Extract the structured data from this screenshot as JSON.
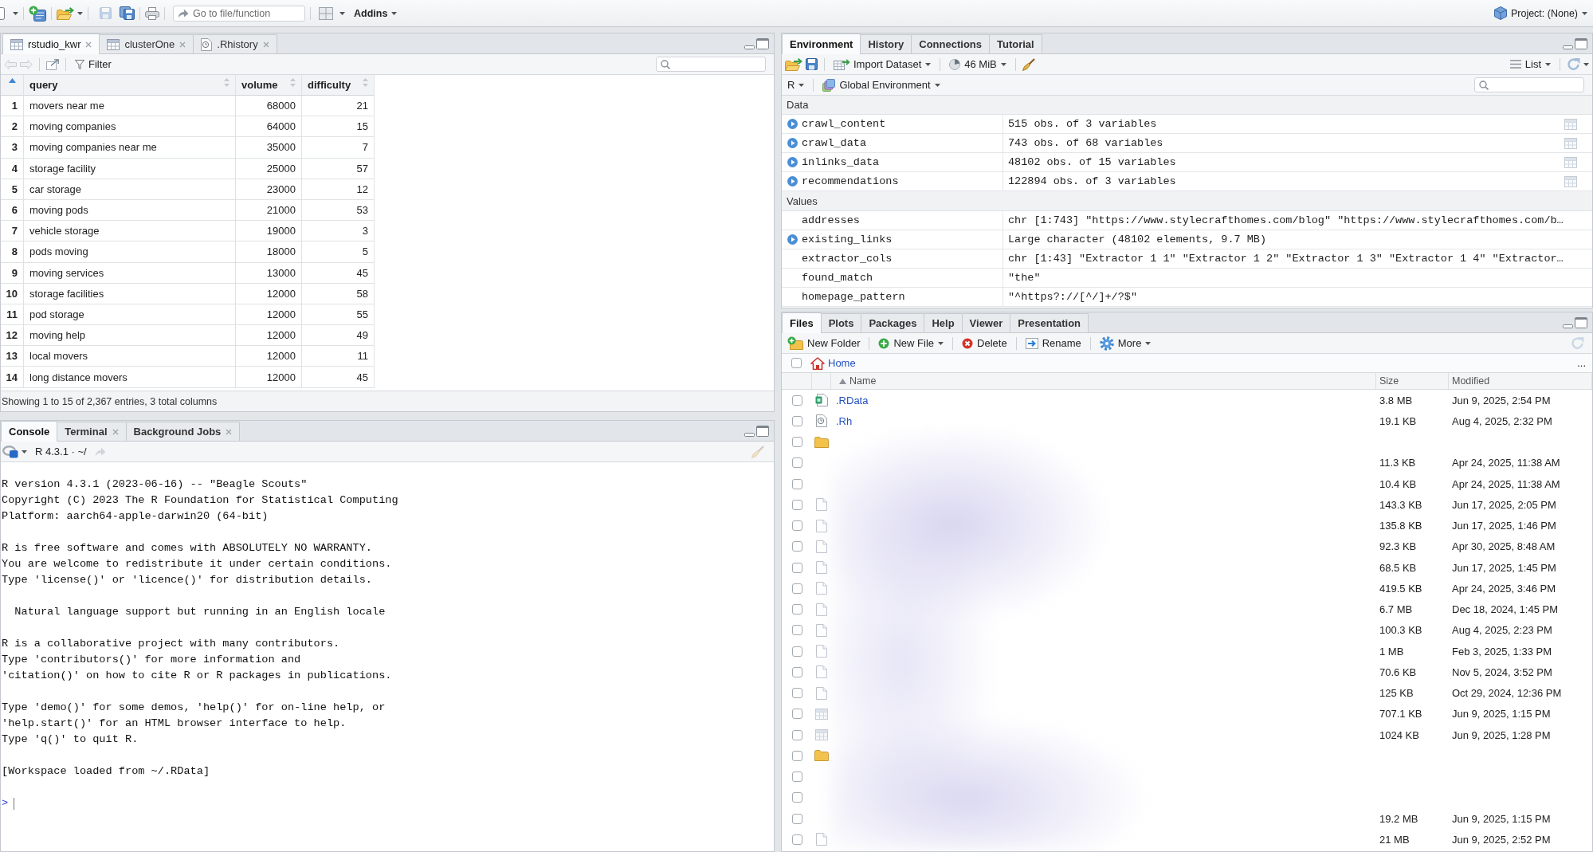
{
  "toolbar": {
    "save": {
      "disabled": true
    },
    "goto": {
      "placeholder": "Go to file/function"
    },
    "addins": "Addins",
    "project": "Project: (None)"
  },
  "source_pane": {
    "tabs": [
      {
        "label": "rstudio_kwr",
        "kind": "table",
        "closable": true,
        "selected": true
      },
      {
        "label": "clusterOne",
        "kind": "table",
        "closable": true,
        "selected": false
      },
      {
        "label": ".Rhistory",
        "kind": "history",
        "closable": true,
        "selected": false
      }
    ],
    "history_nav": {
      "disabled": true
    },
    "filter": "Filter",
    "table": {
      "index_sorted": true,
      "columns": [
        "query",
        "volume",
        "difficulty"
      ],
      "rows": [
        {
          "index": "1",
          "cells": [
            "movers near me",
            "68000",
            "21"
          ]
        },
        {
          "index": "2",
          "cells": [
            "moving companies",
            "64000",
            "15"
          ]
        },
        {
          "index": "3",
          "cells": [
            "moving companies near me",
            "35000",
            "7"
          ]
        },
        {
          "index": "4",
          "cells": [
            "storage facility",
            "25000",
            "57"
          ]
        },
        {
          "index": "5",
          "cells": [
            "car storage",
            "23000",
            "12"
          ]
        },
        {
          "index": "6",
          "cells": [
            "moving pods",
            "21000",
            "53"
          ]
        },
        {
          "index": "7",
          "cells": [
            "vehicle storage",
            "19000",
            "3"
          ]
        },
        {
          "index": "8",
          "cells": [
            "pods moving",
            "18000",
            "5"
          ]
        },
        {
          "index": "9",
          "cells": [
            "moving services",
            "13000",
            "45"
          ]
        },
        {
          "index": "10",
          "cells": [
            "storage facilities",
            "12000",
            "58"
          ]
        },
        {
          "index": "11",
          "cells": [
            "pod storage",
            "12000",
            "55"
          ]
        },
        {
          "index": "12",
          "cells": [
            "moving help",
            "12000",
            "49"
          ]
        },
        {
          "index": "13",
          "cells": [
            "local movers",
            "12000",
            "11"
          ]
        },
        {
          "index": "14",
          "cells": [
            "long distance movers",
            "12000",
            "45"
          ]
        }
      ]
    },
    "footer": "Showing 1 to 15 of 2,367 entries, 3 total columns"
  },
  "console_pane": {
    "tabs": [
      {
        "label": "Console",
        "closable": false,
        "selected": true
      },
      {
        "label": "Terminal",
        "closable": true,
        "selected": false
      },
      {
        "label": "Background Jobs",
        "closable": true,
        "selected": false
      }
    ],
    "interpreter": "R 4.3.1 · ~/",
    "output": [
      [
        "R version 4.3.1 (2023-06-16) -- \"Beagle Scouts\"",
        "Copyright (C) 2023 The R Foundation for Statistical Computing",
        "Platform: aarch64-apple-darwin20 (64-bit)"
      ],
      [
        "R is free software and comes with ABSOLUTELY NO WARRANTY.",
        "You are welcome to redistribute it under certain conditions.",
        "Type 'license()' or 'licence()' for distribution details."
      ],
      [
        "  Natural language support but running in an English locale"
      ],
      [
        "R is a collaborative project with many contributors.",
        "Type 'contributors()' for more information and",
        "'citation()' on how to cite R or R packages in publications."
      ],
      [
        "Type 'demo()' for some demos, 'help()' for on-line help, or",
        "'help.start()' for an HTML browser interface to help.",
        "Type 'q()' to quit R."
      ],
      [
        "[Workspace loaded from ~/.RData]"
      ]
    ],
    "prompt": ">"
  },
  "environment_pane": {
    "tabs": [
      {
        "label": "Environment",
        "selected": true
      },
      {
        "label": "History",
        "selected": false
      },
      {
        "label": "Connections",
        "selected": false
      },
      {
        "label": "Tutorial",
        "selected": false
      }
    ],
    "import_dataset": "Import Dataset",
    "memory": "46 MiB",
    "view_mode": "List",
    "language": "R",
    "scope": "Global Environment",
    "sections": [
      {
        "title": "Data",
        "items": [
          {
            "name": "crawl_content",
            "value": "515 obs. of 3 variables",
            "expandable": true,
            "viewable": true
          },
          {
            "name": "crawl_data",
            "value": "743 obs. of 68 variables",
            "expandable": true,
            "viewable": true
          },
          {
            "name": "inlinks_data",
            "value": "48102 obs. of 15 variables",
            "expandable": true,
            "viewable": true
          },
          {
            "name": "recommendations",
            "value": "122894 obs. of 3 variables",
            "expandable": true,
            "viewable": true
          }
        ]
      },
      {
        "title": "Values",
        "items": [
          {
            "name": "addresses",
            "value": "chr [1:743] \"https://www.stylecrafthomes.com/blog\" \"https://www.stylecrafthomes.com/b…",
            "expandable": false,
            "viewable": false
          },
          {
            "name": "existing_links",
            "value": "Large character (48102 elements, 9.7 MB)",
            "expandable": true,
            "viewable": false
          },
          {
            "name": "extractor_cols",
            "value": "chr [1:43] \"Extractor 1 1\" \"Extractor 1 2\" \"Extractor 1 3\" \"Extractor 1 4\" \"Extractor…",
            "expandable": false,
            "viewable": false
          },
          {
            "name": "found_match",
            "value": "\"the\"",
            "expandable": false,
            "viewable": false
          },
          {
            "name": "homepage_pattern",
            "value": "\"^https?://[^/]+/?$\"",
            "expandable": false,
            "viewable": false
          }
        ]
      }
    ]
  },
  "files_pane": {
    "tabs": [
      {
        "label": "Files",
        "selected": true
      },
      {
        "label": "Plots",
        "selected": false
      },
      {
        "label": "Packages",
        "selected": false
      },
      {
        "label": "Help",
        "selected": false
      },
      {
        "label": "Viewer",
        "selected": false
      },
      {
        "label": "Presentation",
        "selected": false
      }
    ],
    "actions": [
      {
        "kind": "new-folder",
        "label": "New Folder",
        "menu": false
      },
      {
        "kind": "new-file",
        "label": "New File",
        "menu": true
      },
      {
        "kind": "delete",
        "label": "Delete",
        "menu": false
      },
      {
        "kind": "rename",
        "label": "Rename",
        "menu": false
      },
      {
        "kind": "more",
        "label": "More",
        "menu": true
      }
    ],
    "select_all": {
      "checked": false
    },
    "breadcrumb": "Home",
    "overflow": "...",
    "columns": [
      {
        "label": "Name",
        "sorted": true
      },
      {
        "label": "Size",
        "sorted": false
      },
      {
        "label": "Modified",
        "sorted": false
      }
    ],
    "rows": [
      {
        "kind": "rdata",
        "name": ".RData",
        "size": "3.8 MB",
        "modified": "Jun 9, 2025, 2:54 PM",
        "checked": false
      },
      {
        "kind": "history",
        "name": ".Rh",
        "size": "19.1 KB",
        "modified": "Aug 4, 2025, 2:32 PM",
        "checked": false
      },
      {
        "kind": "folder",
        "checked": false
      },
      {
        "kind": "none",
        "size": "11.3 KB",
        "modified": "Apr 24, 2025, 11:38 AM",
        "checked": false
      },
      {
        "kind": "none",
        "size": "10.4 KB",
        "modified": "Apr 24, 2025, 11:38 AM",
        "checked": false
      },
      {
        "kind": "file",
        "size": "143.3 KB",
        "modified": "Jun 17, 2025, 2:05 PM",
        "checked": false
      },
      {
        "kind": "file",
        "size": "135.8 KB",
        "modified": "Jun 17, 2025, 1:46 PM",
        "checked": false
      },
      {
        "kind": "file",
        "size": "92.3 KB",
        "modified": "Apr 30, 2025, 8:48 AM",
        "checked": false
      },
      {
        "kind": "file",
        "size": "68.5 KB",
        "modified": "Jun 17, 2025, 1:45 PM",
        "checked": false
      },
      {
        "kind": "file",
        "size": "419.5 KB",
        "modified": "Apr 24, 2025, 3:46 PM",
        "checked": false
      },
      {
        "kind": "file",
        "size": "6.7 MB",
        "modified": "Dec 18, 2024, 1:45 PM",
        "checked": false
      },
      {
        "kind": "file",
        "size": "100.3 KB",
        "modified": "Aug 4, 2025, 2:23 PM",
        "checked": false
      },
      {
        "kind": "file",
        "size": "1 MB",
        "modified": "Feb 3, 2025, 1:33 PM",
        "checked": false
      },
      {
        "kind": "file",
        "size": "70.6 KB",
        "modified": "Nov 5, 2024, 3:52 PM",
        "checked": false
      },
      {
        "kind": "file",
        "size": "125 KB",
        "modified": "Oct 29, 2024, 12:36 PM",
        "checked": false
      },
      {
        "kind": "table",
        "size": "707.1 KB",
        "modified": "Jun 9, 2025, 1:15 PM",
        "checked": false
      },
      {
        "kind": "table",
        "size": "1024 KB",
        "modified": "Jun 9, 2025, 1:28 PM",
        "checked": false
      },
      {
        "kind": "folder",
        "checked": false
      },
      {
        "kind": "none",
        "checked": false
      },
      {
        "kind": "none",
        "checked": false
      },
      {
        "kind": "none",
        "size": "19.2 MB",
        "modified": "Jun 9, 2025, 1:15 PM",
        "checked": false
      },
      {
        "kind": "file",
        "size": "21 MB",
        "modified": "Jun 9, 2025, 2:52 PM",
        "checked": false
      }
    ]
  }
}
